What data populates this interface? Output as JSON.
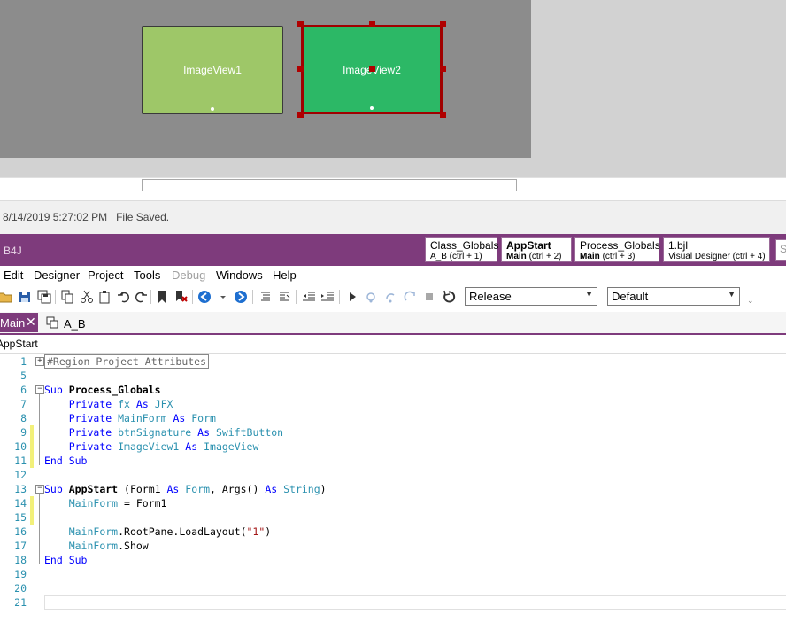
{
  "designer": {
    "imageview1_label": "ImageView1",
    "imageview2_label": "ImageView2",
    "imageview1_color": "#9ec768",
    "imageview2_color": "#2cb866",
    "selection_color": "#a00000",
    "status_text": "8/14/2019 5:27:02 PM   File Saved."
  },
  "ide": {
    "app_title": "B4J",
    "quick_tabs": [
      {
        "title": "Class_Globals",
        "module": "",
        "shortcut": "A_B  (ctrl + 1)"
      },
      {
        "title": "AppStart",
        "module": "Main",
        "shortcut": "(ctrl + 2)"
      },
      {
        "title": "Process_Globals",
        "module": "Main",
        "shortcut": "(ctrl + 3)"
      },
      {
        "title": "1.bjl",
        "module": "",
        "shortcut": "Visual Designer  (ctrl + 4)"
      }
    ],
    "search_placeholder": "S",
    "accent_color": "#7e3b7c"
  },
  "menu": [
    "Edit",
    "Designer",
    "Project",
    "Tools",
    "Debug",
    "Windows",
    "Help"
  ],
  "toolbar": {
    "build_config": "Release",
    "build_target": "Default"
  },
  "tabs": {
    "main_label": "Main",
    "ab_label": "A_B"
  },
  "breadcrumb": "AppStart",
  "code": {
    "region_label": "#Region Project Attributes",
    "line_numbers": [
      "1",
      "5",
      "6",
      "7",
      "8",
      "9",
      "10",
      "11",
      "12",
      "13",
      "14",
      "15",
      "16",
      "17",
      "18",
      "19",
      "20",
      "21"
    ]
  }
}
